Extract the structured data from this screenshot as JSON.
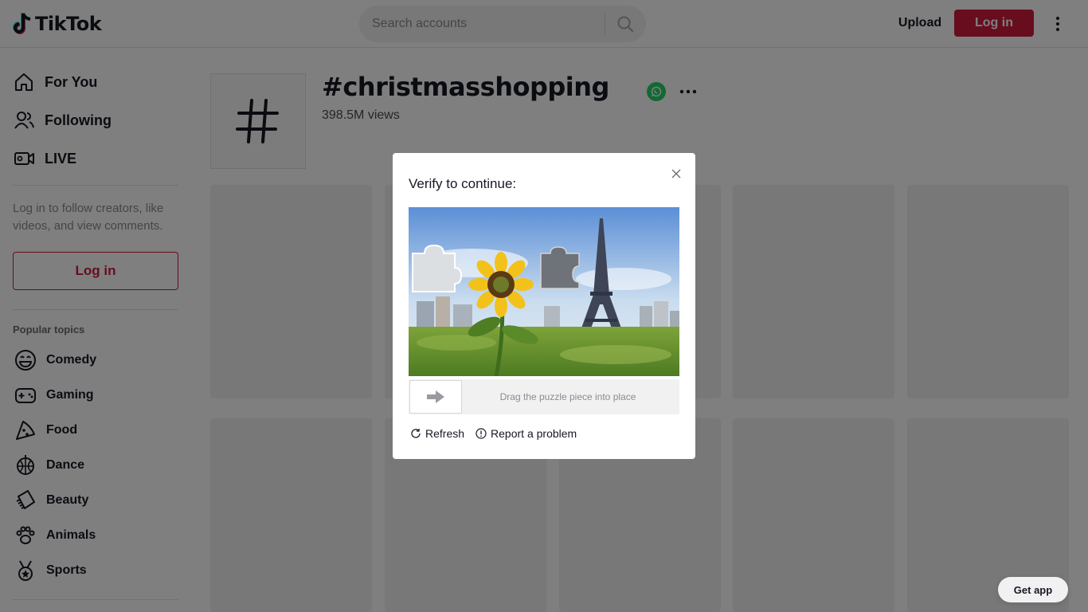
{
  "header": {
    "logo_text": "TikTok",
    "search_placeholder": "Search accounts",
    "upload_label": "Upload",
    "login_label": "Log in"
  },
  "sidebar": {
    "nav": [
      {
        "label": "For You",
        "icon": "home-icon"
      },
      {
        "label": "Following",
        "icon": "people-icon"
      },
      {
        "label": "LIVE",
        "icon": "live-icon"
      }
    ],
    "login_hint": "Log in to follow creators, like videos, and view comments.",
    "login_label": "Log in",
    "popular_title": "Popular topics",
    "topics": [
      {
        "label": "Comedy",
        "icon": "smiley-icon"
      },
      {
        "label": "Gaming",
        "icon": "gamepad-icon"
      },
      {
        "label": "Food",
        "icon": "pizza-icon"
      },
      {
        "label": "Dance",
        "icon": "disco-ball-icon"
      },
      {
        "label": "Beauty",
        "icon": "comb-icon"
      },
      {
        "label": "Animals",
        "icon": "paw-icon"
      },
      {
        "label": "Sports",
        "icon": "medal-icon"
      }
    ]
  },
  "tag": {
    "title": "#christmasshopping",
    "views": "398.5M views"
  },
  "captcha": {
    "title": "Verify to continue:",
    "slider_hint": "Drag the puzzle piece into place",
    "refresh_label": "Refresh",
    "report_label": "Report a problem"
  },
  "get_app_label": "Get app",
  "colors": {
    "brand": "#fe2c55",
    "login_button": "#cf1a3d",
    "whatsapp": "#25d366"
  }
}
